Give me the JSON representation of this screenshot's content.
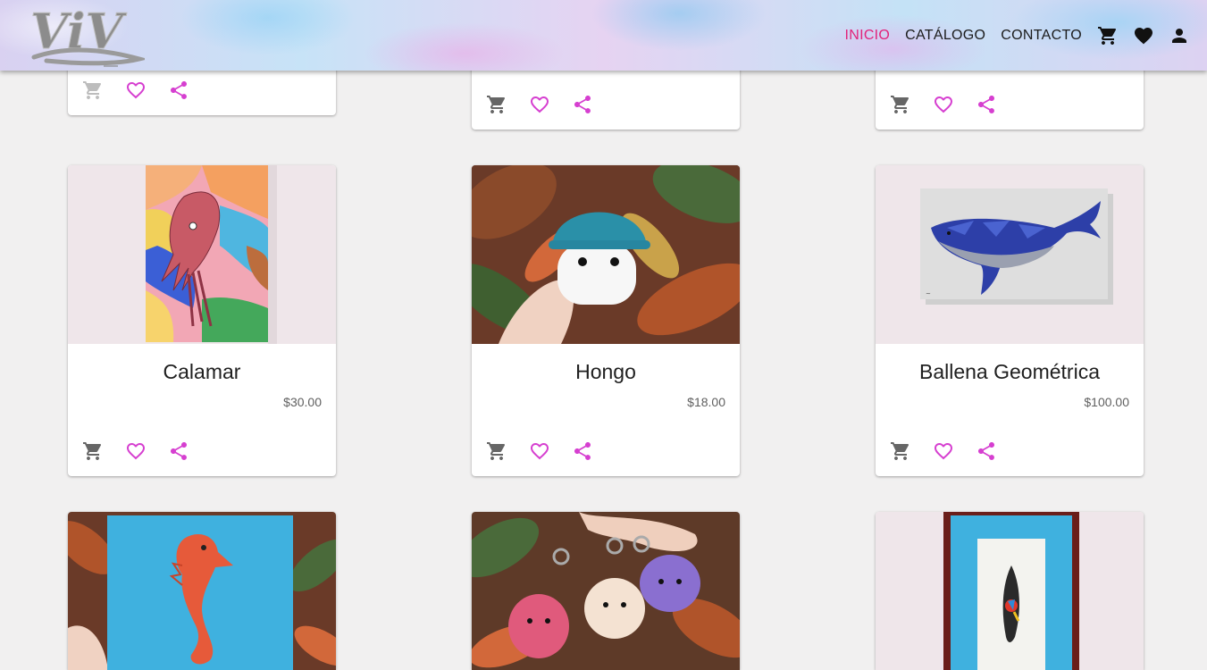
{
  "header": {
    "logo_alt": "ViV",
    "nav": [
      "INICIO",
      "CATÁLOGO",
      "CONTACTO"
    ],
    "active": "INICIO"
  },
  "colors": {
    "accent": "#e2237a",
    "icon_pink": "#d63fd0",
    "icon_gray": "#666666"
  },
  "products": [
    {
      "title": "Calamar",
      "price": "$30.00",
      "image": "squid-painting"
    },
    {
      "title": "Hongo",
      "price": "$18.00",
      "image": "crochet-mushroom"
    },
    {
      "title": "Ballena Geométrica",
      "price": "$100.00",
      "image": "geometric-whale"
    }
  ],
  "lower_row_images": [
    "seahorse-painting",
    "crochet-keychains",
    "framed-surfboard-parrot"
  ]
}
